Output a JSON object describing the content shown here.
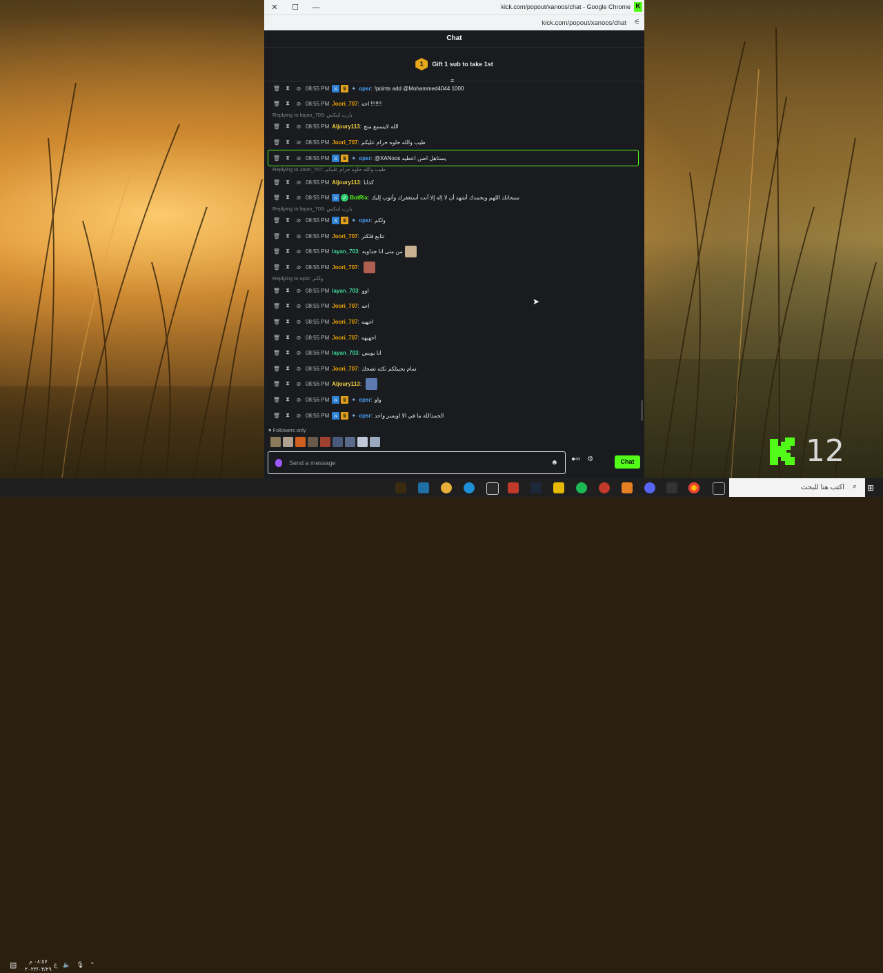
{
  "window": {
    "title": "kick.com/popout/xanoos/chat - Google Chrome",
    "url": "kick.com/popout/xanoos/chat",
    "chrome_badge": "K",
    "close": "✕",
    "maximize": "☐",
    "minimize": "—"
  },
  "chat": {
    "header": "Chat",
    "pinned_rank": "1",
    "pinned_text": "Gift 1 sub to take 1st",
    "followers_only": "Followers only",
    "input_placeholder": "Send a message",
    "chat_button": "Chat",
    "infinity": "∞"
  },
  "messages": [
    {
      "time": "08:55 PM",
      "user": "opsr",
      "color": "#4aa3ff",
      "badges": [
        "mod",
        "vip",
        "og"
      ],
      "text": "!points add @Mohammed4044 1000"
    },
    {
      "time": "08:55 PM",
      "user": "Joori_707",
      "color": "#f0a500",
      "badges": [],
      "text": "احه !!!!!!!"
    },
    {
      "reply": "Replying to layan_703: يارب ابتكس"
    },
    {
      "time": "08:55 PM",
      "user": "Aljoury113",
      "color": "#f5d142",
      "badges": [],
      "text": "الله لايسمع منج"
    },
    {
      "time": "08:55 PM",
      "user": "Joori_707",
      "color": "#f0a500",
      "badges": [],
      "text": "طيب والله حلوه حرام عليكم"
    },
    {
      "time": "08:55 PM",
      "user": "opsr",
      "color": "#4aa3ff",
      "badges": [
        "mod",
        "vip",
        "og"
      ],
      "text": "@XANoos يستاهل اضن اعطيه"
    },
    {
      "reply": "Replying to Joori_707: طيب والله حلوه حرام عليكم"
    },
    {
      "time": "08:55 PM",
      "user": "Aljoury113",
      "color": "#f5d142",
      "badges": [],
      "text": "كذابا"
    },
    {
      "time": "08:55 PM",
      "user": "BotRix",
      "color": "#53fc18",
      "badges": [
        "mod",
        "verified"
      ],
      "text": "سبحانك اللهم وبحمدك أشهد أن لا إله إلا أنت أستغفرك وأتوب إليك"
    },
    {
      "reply": "Replying to layan_703: يارب ابتكس"
    },
    {
      "time": "08:55 PM",
      "user": "opsr",
      "color": "#4aa3ff",
      "badges": [
        "mod",
        "vip",
        "og"
      ],
      "text": "ولكم"
    },
    {
      "time": "08:55 PM",
      "user": "Joori_707",
      "color": "#f0a500",
      "badges": [],
      "text": "تتابع فلكتر"
    },
    {
      "time": "08:55 PM",
      "user": "layan_703",
      "color": "#3ddc97",
      "badges": [],
      "text": "من متى انا جداويه",
      "emote": "emote-photo"
    },
    {
      "time": "08:55 PM",
      "user": "Joori_707",
      "color": "#f0a500",
      "badges": [],
      "text": "",
      "emote": "emote-face"
    },
    {
      "reply": "Replying to opsr: ولكم"
    },
    {
      "time": "08:55 PM",
      "user": "layan_703",
      "color": "#3ddc97",
      "badges": [],
      "text": "اوو"
    },
    {
      "time": "08:55 PM",
      "user": "Joori_707",
      "color": "#f0a500",
      "badges": [],
      "text": "احه"
    },
    {
      "time": "08:55 PM",
      "user": "Joori_707",
      "color": "#f0a500",
      "badges": [],
      "text": "احهيه"
    },
    {
      "time": "08:55 PM",
      "user": "Joori_707",
      "color": "#f0a500",
      "badges": [],
      "text": "احهيهه"
    },
    {
      "time": "08:56 PM",
      "user": "layan_703",
      "color": "#3ddc97",
      "badges": [],
      "text": "انا بويس"
    },
    {
      "time": "08:56 PM",
      "user": "Joori_707",
      "color": "#f0a500",
      "badges": [],
      "text": "تمام بجيبلكم نكته تضحك"
    },
    {
      "time": "08:56 PM",
      "user": "Aljoury113",
      "color": "#f5d142",
      "badges": [],
      "text": "",
      "emote": "emote-man"
    },
    {
      "time": "08:56 PM",
      "user": "opsr",
      "color": "#4aa3ff",
      "badges": [
        "mod",
        "vip",
        "og"
      ],
      "text": "واو"
    },
    {
      "time": "08:56 PM",
      "user": "opsr",
      "color": "#4aa3ff",
      "badges": [
        "mod",
        "vip",
        "og"
      ],
      "text": "الحمدالله ما في الا اوبسر واحد"
    }
  ],
  "taskbar": {
    "search_placeholder": "اكتب هنا للبحث",
    "time": "٠٨:٥٧ م",
    "date": "٢٠٢٣/٠٣/٢٩",
    "lang": "ع"
  },
  "desktop": {
    "overlay_number": "12"
  }
}
